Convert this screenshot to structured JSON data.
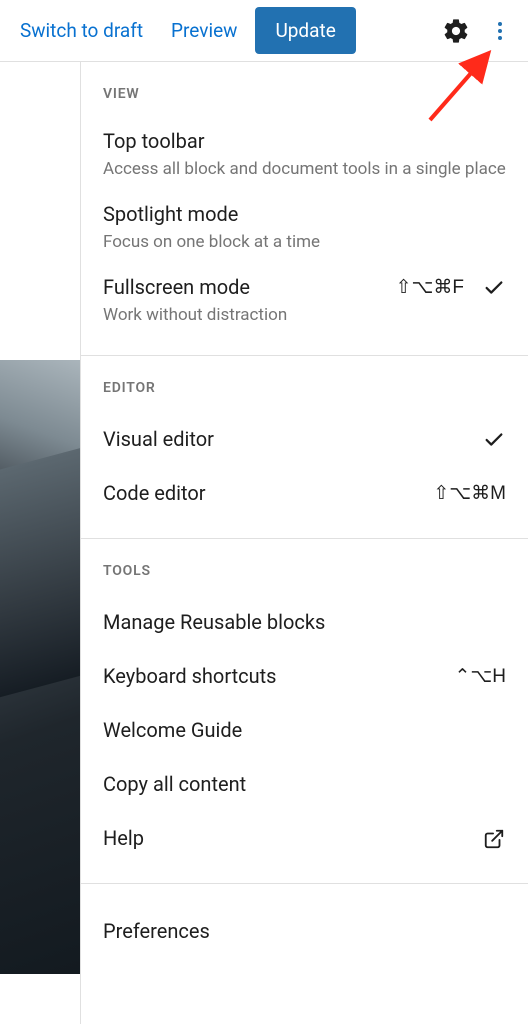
{
  "topbar": {
    "draft": "Switch to draft",
    "preview": "Preview",
    "update": "Update"
  },
  "menu": {
    "view": {
      "heading": "VIEW",
      "items": [
        {
          "title": "Top toolbar",
          "desc": "Access all block and document tools in a single place",
          "shortcut": "",
          "checked": false
        },
        {
          "title": "Spotlight mode",
          "desc": "Focus on one block at a time",
          "shortcut": "",
          "checked": false
        },
        {
          "title": "Fullscreen mode",
          "desc": "Work without distraction",
          "shortcut": "⇧⌥⌘F",
          "checked": true
        }
      ]
    },
    "editor": {
      "heading": "EDITOR",
      "items": [
        {
          "title": "Visual editor",
          "shortcut": "",
          "checked": true
        },
        {
          "title": "Code editor",
          "shortcut": "⇧⌥⌘M",
          "checked": false
        }
      ]
    },
    "tools": {
      "heading": "TOOLS",
      "items": [
        {
          "title": "Manage Reusable blocks",
          "shortcut": "",
          "external": false
        },
        {
          "title": "Keyboard shortcuts",
          "shortcut": "⌃⌥H",
          "external": false
        },
        {
          "title": "Welcome Guide",
          "shortcut": "",
          "external": false
        },
        {
          "title": "Copy all content",
          "shortcut": "",
          "external": false
        },
        {
          "title": "Help",
          "shortcut": "",
          "external": true
        }
      ]
    },
    "prefs": {
      "items": [
        {
          "title": "Preferences"
        }
      ]
    }
  }
}
